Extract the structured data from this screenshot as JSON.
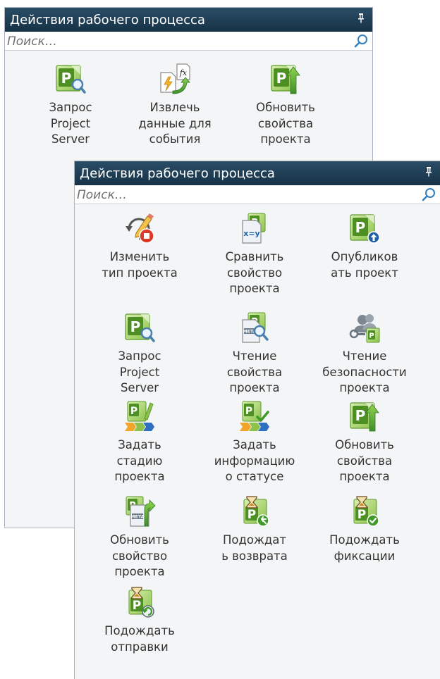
{
  "back_panel": {
    "title": "Действия рабочего процесса",
    "search_placeholder": "Поиск…",
    "actions": [
      {
        "label": "Запрос\nProject\nServer",
        "icon": "project-query-icon"
      },
      {
        "label": "Извлечь\nданные для\nсобытия",
        "icon": "extract-event-data-icon"
      },
      {
        "label": "Обновить\nсвойства\nпроекта",
        "icon": "update-project-properties-icon"
      }
    ]
  },
  "front_panel": {
    "title": "Действия рабочего процесса",
    "search_placeholder": "Поиск…",
    "actions": [
      {
        "label": "Изменить\nтип проекта",
        "icon": "change-project-type-icon"
      },
      {
        "label": "Сравнить\nсвойство\nпроекта",
        "icon": "compare-project-property-icon"
      },
      {
        "label": "Опубликов\nать проект",
        "icon": "publish-project-icon"
      },
      {
        "label": "Запрос\nProject\nServer",
        "icon": "project-query-icon"
      },
      {
        "label": "Чтение\nсвойства\nпроекта",
        "icon": "read-project-property-icon"
      },
      {
        "label": "Чтение\nбезопасности\nпроекта",
        "icon": "read-project-security-icon"
      },
      {
        "label": "Задать\nстадию\nпроекта",
        "icon": "set-project-stage-icon"
      },
      {
        "label": "Задать\nинформацию\nо статусе",
        "icon": "set-status-info-icon"
      },
      {
        "label": "Обновить\nсвойства\nпроекта",
        "icon": "update-project-properties-icon"
      },
      {
        "label": "Обновить\nсвойство\nпроекта",
        "icon": "update-project-property-icon"
      },
      {
        "label": "Подождат\nь возврата",
        "icon": "wait-for-checkin-icon"
      },
      {
        "label": "Подождать\nфиксации",
        "icon": "wait-for-commit-icon"
      },
      {
        "label": "Подождать\nотправки",
        "icon": "wait-for-submit-icon"
      }
    ]
  },
  "colors": {
    "header_bg": "#1f4259",
    "panel_bg": "#f4f5f6",
    "project_green": "#6aa333",
    "search_blue": "#2f7fc1"
  }
}
